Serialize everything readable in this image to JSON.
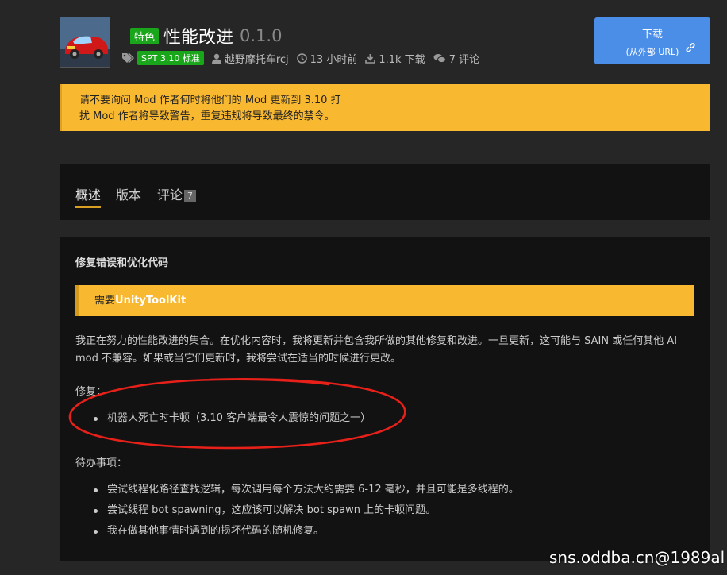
{
  "header": {
    "featured_badge": "特色",
    "mod_name": "性能改进",
    "version": "0.1.0",
    "spt_badge": "SPT 3.10 标准",
    "author": "越野摩托车rcj",
    "updated": "13 小时前",
    "downloads": "1.1k 下载",
    "comments": "7 评论",
    "download_button": {
      "title": "下载",
      "subtitle": "(从外部 URL)"
    }
  },
  "warning": {
    "line1": "请不要询问 Mod 作者何时将他们的 Mod 更新到 3.10 打",
    "line2": "扰 Mod 作者将导致警告，重复违规将导致最终的禁令。"
  },
  "tabs": [
    {
      "label": "概述",
      "active": true
    },
    {
      "label": "版本",
      "active": false
    },
    {
      "label": "评论",
      "badge": "7",
      "active": false
    }
  ],
  "content": {
    "heading": "修复错误和优化代码",
    "require_prefix": "需要",
    "require_name": "UnityToolKit",
    "intro": "我正在努力的性能改进的集合。在优化内容时，我将更新并包含我所做的其他修复和改进。一旦更新，这可能与 SAIN 或任何其他 AI mod 不兼容。如果或当它们更新时，我将尝试在适当的时候进行更改。",
    "fixes_label": "修复：",
    "fixes": [
      "机器人死亡时卡顿（3.10 客户端最令人震惊的问题之一）"
    ],
    "todo_label": "待办事项：",
    "todo": [
      "尝试线程化路径查找逻辑，每次调用每个方法大约需要 6-12 毫秒，并且可能是多线程的。",
      "尝试线程 bot spawning，这应该可以解决 bot spawn 上的卡顿问题。",
      "我在做其他事情时遇到的损坏代码的随机修复。"
    ]
  },
  "watermark": "sns.oddba.cn@1989al",
  "colors": {
    "background": "#262626",
    "panel": "#121212",
    "warning": "#f8b830",
    "badge_green": "#1aa61a",
    "download_blue": "#4b8ee8",
    "annotation_red": "#e8201a"
  }
}
